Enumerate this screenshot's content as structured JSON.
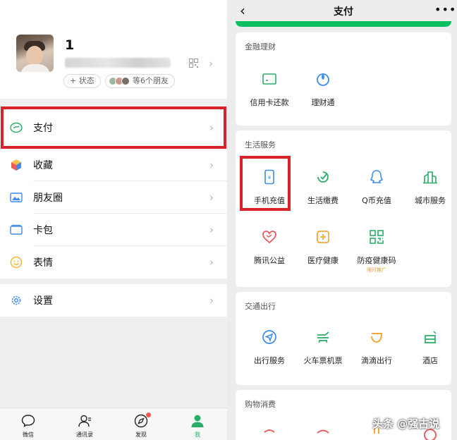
{
  "profile": {
    "name": "1",
    "status_label": "+ 状态",
    "friends_label": "等6个朋友"
  },
  "menu": {
    "pay": "支付",
    "favorites": "收藏",
    "moments": "朋友圈",
    "cards": "卡包",
    "stickers": "表情",
    "settings": "设置"
  },
  "tabbar": {
    "chats": "微信",
    "contacts": "通讯录",
    "discover": "发现",
    "me": "我"
  },
  "pay_page": {
    "title": "支付",
    "sections": {
      "finance": {
        "title": "金融理财",
        "items": [
          "信用卡还款",
          "理财通"
        ]
      },
      "life": {
        "title": "生活服务",
        "items": [
          "手机充值",
          "生活缴费",
          "Q币充值",
          "城市服务",
          "腾讯公益",
          "医疗健康",
          "防疫健康码"
        ],
        "promo_tag": "限时推广"
      },
      "transport": {
        "title": "交通出行",
        "items": [
          "出行服务",
          "火车票机票",
          "滴滴出行",
          "酒店"
        ]
      },
      "shopping": {
        "title": "购物消费"
      }
    }
  },
  "watermark": "头条 @强古说",
  "colors": {
    "wechat_green": "#07c160",
    "highlight_red": "#d8232a",
    "icon_green": "#2aae67",
    "icon_blue": "#3d8ae8",
    "icon_red": "#e85c5c",
    "icon_orange": "#f2a73b"
  }
}
